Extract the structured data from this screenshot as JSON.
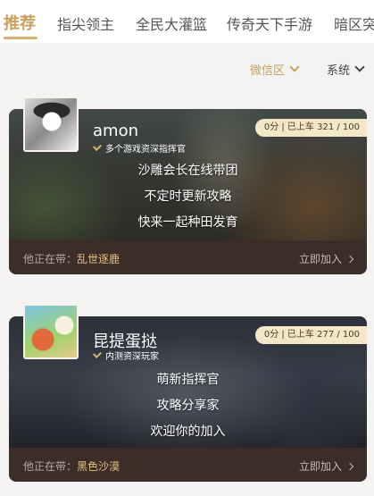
{
  "tabs": [
    {
      "label": "推荐",
      "active": true
    },
    {
      "label": "指尖领主"
    },
    {
      "label": "全民大灌篮"
    },
    {
      "label": "传奇天下手游"
    },
    {
      "label": "暗区突"
    }
  ],
  "filters": {
    "zone": "微信区",
    "system": "系统"
  },
  "cards": [
    {
      "name": "amon",
      "subtitle": "多个游戏资深指挥官",
      "badge": "0分 | 已上车 321 / 100",
      "lines": [
        "沙雕会长在线带团",
        "不定时更新攻略",
        "快来一起种田发育"
      ],
      "footer_prefix": "他正在带：",
      "footer_game": "乱世逐鹿",
      "join": "立即加入"
    },
    {
      "name": "昆提蛋挞",
      "subtitle": "内测资深玩家",
      "badge": "0分 | 已上车 277 / 100",
      "lines": [
        "萌新指挥官",
        "攻略分享家",
        "欢迎你的加入"
      ],
      "footer_prefix": "他正在带：",
      "footer_game": "黑色沙漠",
      "join": "立即加入"
    }
  ],
  "colors": {
    "accent": "#c9a15d",
    "card_footer": "#3c2d28",
    "badge_bg": "#f4e7c8"
  }
}
